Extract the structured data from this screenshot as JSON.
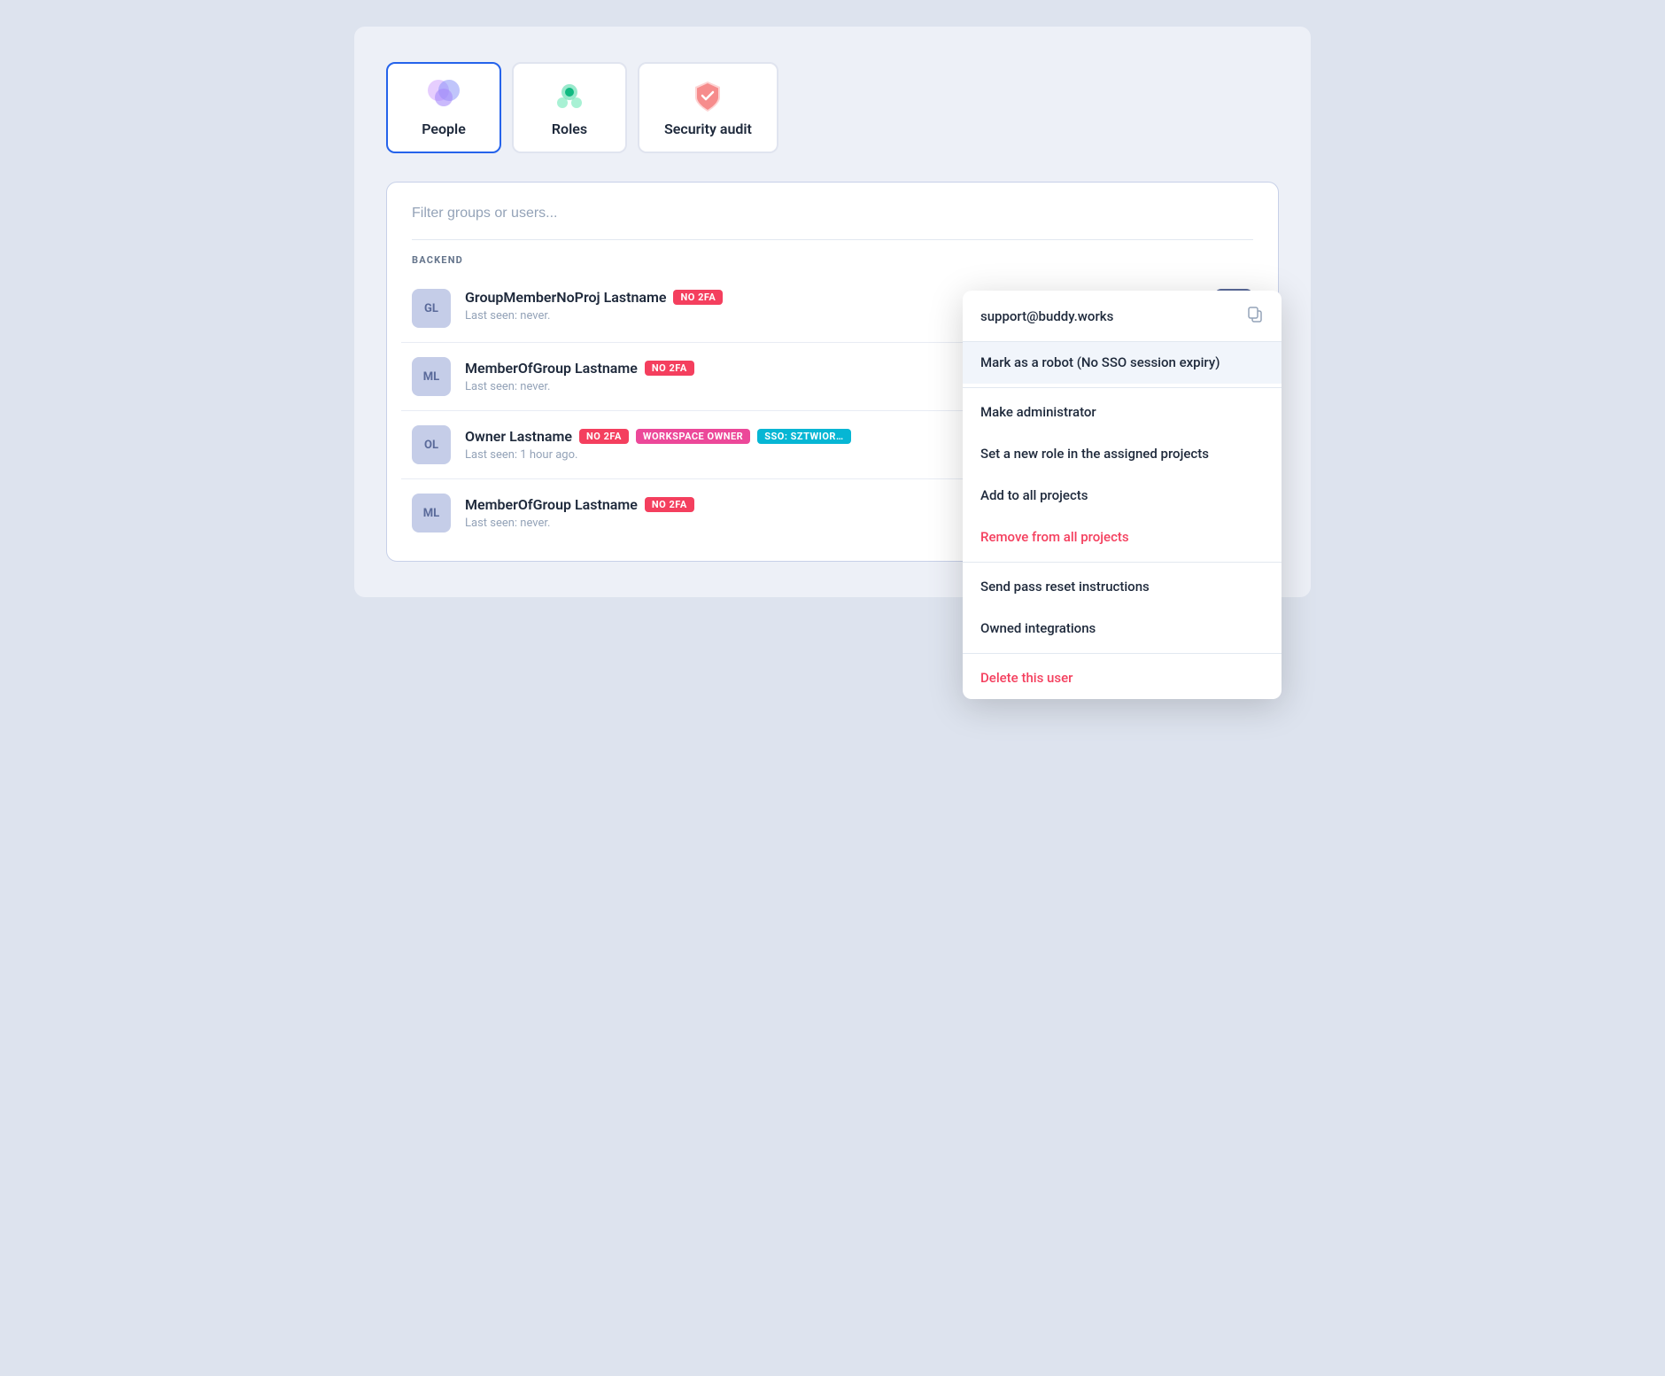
{
  "tabs": [
    {
      "id": "people",
      "label": "People",
      "active": true,
      "icon": "people"
    },
    {
      "id": "roles",
      "label": "Roles",
      "active": false,
      "icon": "roles"
    },
    {
      "id": "security-audit",
      "label": "Security audit",
      "active": false,
      "icon": "security"
    }
  ],
  "filter": {
    "placeholder": "Filter groups or users..."
  },
  "group": {
    "label": "BACKEND"
  },
  "users": [
    {
      "initials": "GL",
      "name": "GroupMemberNoProj Lastname",
      "badges": [
        {
          "text": "NO 2FA",
          "type": "no2fa"
        }
      ],
      "meta": "Last seen: never.",
      "hasMenu": true
    },
    {
      "initials": "ML",
      "name": "MemberOfGroup Lastname",
      "badges": [
        {
          "text": "NO 2FA",
          "type": "no2fa"
        }
      ],
      "meta": "Last seen: never.",
      "hasMenu": false
    },
    {
      "initials": "OL",
      "name": "Owner Lastname",
      "badges": [
        {
          "text": "NO 2FA",
          "type": "no2fa"
        },
        {
          "text": "WORKSPACE OWNER",
          "type": "workspace-owner"
        },
        {
          "text": "SSO: SZTWIOR…",
          "type": "sso"
        }
      ],
      "meta": "Last seen: 1 hour ago.",
      "hasMenu": false
    },
    {
      "initials": "ML",
      "name": "MemberOfGroup Lastname",
      "badges": [
        {
          "text": "NO 2FA",
          "type": "no2fa"
        }
      ],
      "meta": "Last seen: never.",
      "hasMenu": false
    }
  ],
  "contextMenu": {
    "email": "support@buddy.works",
    "items": [
      {
        "id": "mark-robot",
        "label": "Mark as a robot (No SSO session expiry)",
        "type": "highlight",
        "danger": false
      },
      {
        "id": "make-admin",
        "label": "Make administrator",
        "type": "normal",
        "danger": false
      },
      {
        "id": "set-role",
        "label": "Set a new role in the assigned projects",
        "type": "normal",
        "danger": false
      },
      {
        "id": "add-all-projects",
        "label": "Add to all projects",
        "type": "normal",
        "danger": false
      },
      {
        "id": "remove-all-projects",
        "label": "Remove from all projects",
        "type": "normal",
        "danger": true
      },
      {
        "id": "send-pass-reset",
        "label": "Send pass reset instructions",
        "type": "normal",
        "danger": false
      },
      {
        "id": "owned-integrations",
        "label": "Owned integrations",
        "type": "normal",
        "danger": false
      },
      {
        "id": "delete-user",
        "label": "Delete this user",
        "type": "normal",
        "danger": true
      }
    ]
  }
}
